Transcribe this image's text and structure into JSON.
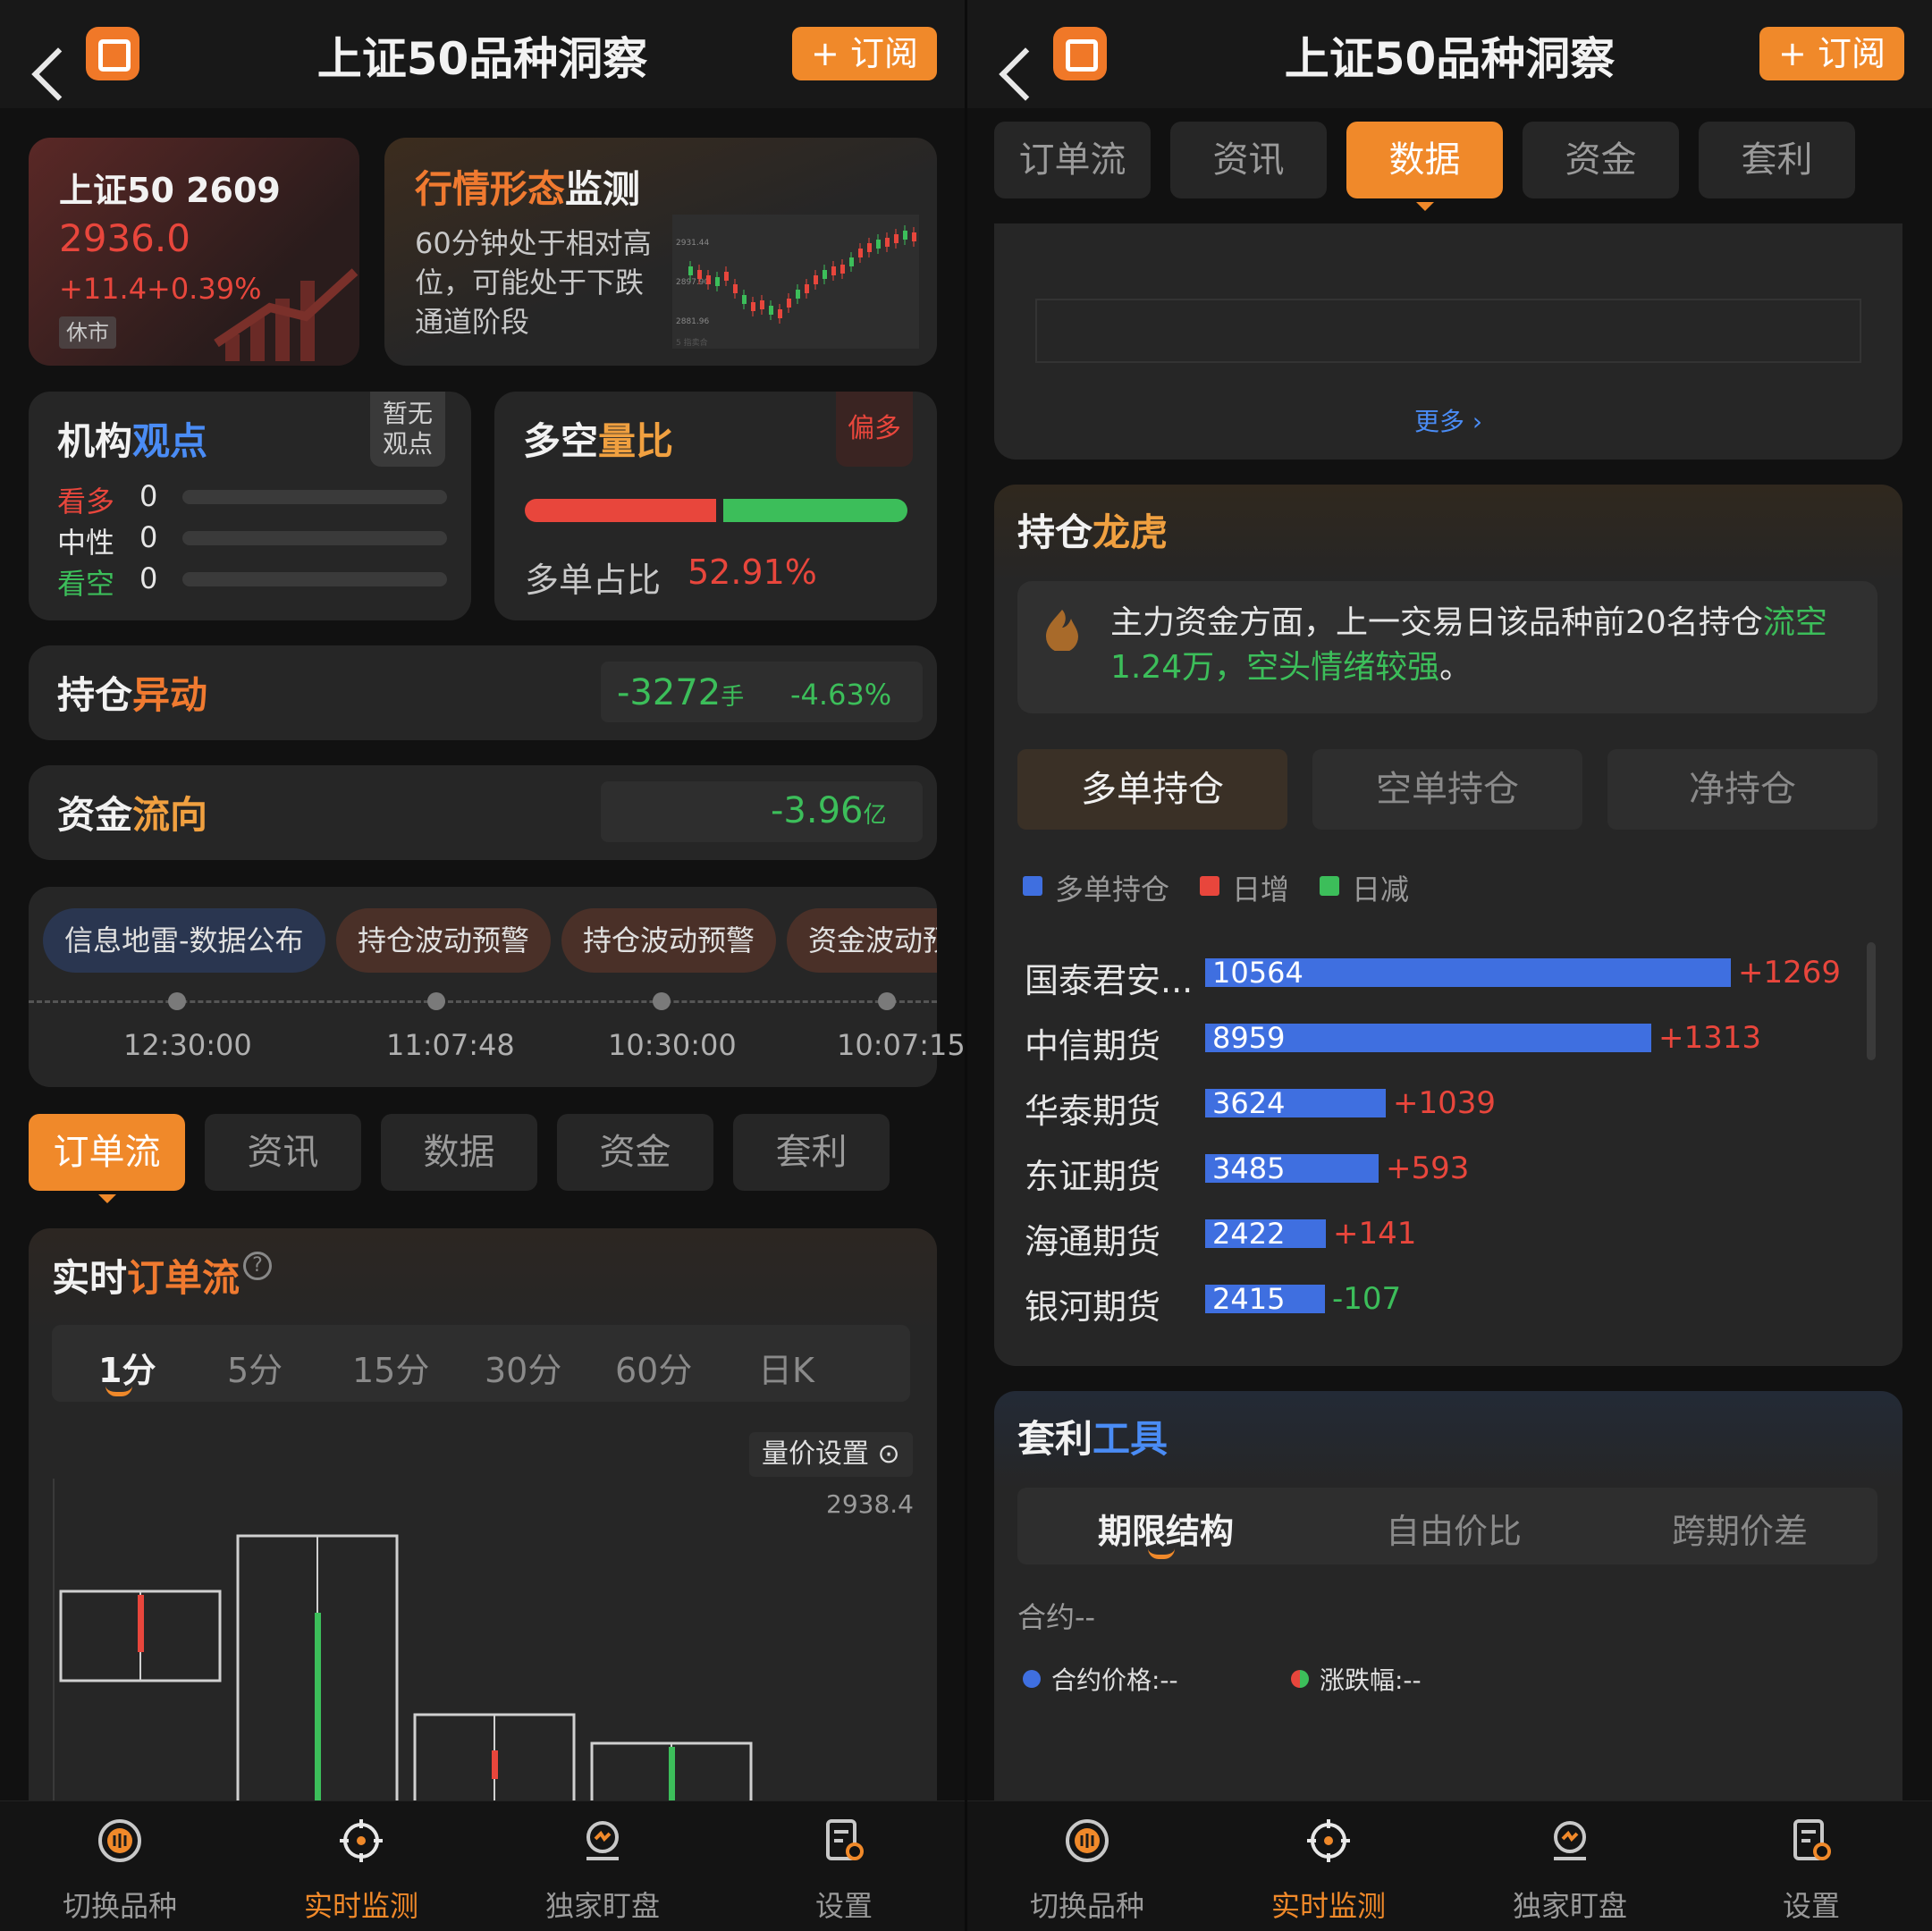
{
  "header": {
    "title": "上证50品种洞察",
    "subscribe_label": "+ 订阅"
  },
  "quote": {
    "name": "上证50 2609",
    "price": "2936.0",
    "change": "+11.4",
    "change_pct": "+0.39%",
    "status": "休市"
  },
  "pattern": {
    "title_a": "行情形态",
    "title_b": "监测",
    "desc": "60分钟处于相对高位，可能处于下跌通道阶段",
    "mini_price_top": "2931.44",
    "mini_price_mid": "2897.90",
    "mini_price_bot": "2881.96",
    "mini_caption": "5 指卖合"
  },
  "views": {
    "title_a": "机构",
    "title_b": "观点",
    "badge": "暂无\n观点",
    "rows": [
      {
        "label": "看多",
        "value": "0"
      },
      {
        "label": "中性",
        "value": "0"
      },
      {
        "label": "看空",
        "value": "0"
      }
    ]
  },
  "longshort": {
    "title_a": "多空",
    "title_b": "量比",
    "badge": "偏多",
    "ratio_label": "多单占比",
    "ratio_value": "52.91%",
    "long_fraction": 0.5291
  },
  "position_change": {
    "title_a": "持仓",
    "title_b": "异动",
    "value": "-3272",
    "unit": "手",
    "pct": "-4.63%"
  },
  "fund_flow": {
    "title_a": "资金",
    "title_b": "流向",
    "value": "-3.96",
    "unit": "亿"
  },
  "timeline": {
    "pills": [
      "信息地雷-数据公布",
      "持仓波动预警",
      "持仓波动预警",
      "资金波动预"
    ],
    "times": [
      "12:30:00",
      "11:07:48",
      "10:30:00",
      "10:07:15"
    ]
  },
  "main_tabs": [
    "订单流",
    "资讯",
    "数据",
    "资金",
    "套利"
  ],
  "orderflow": {
    "title_a": "实时",
    "title_b": "订单流",
    "help_icon": "question-circle-icon",
    "periods": [
      "1分",
      "5分",
      "15分",
      "30分",
      "60分",
      "日K"
    ],
    "setting_label": "量价设置",
    "price_label": "2938.4"
  },
  "data_panel": {
    "more_label": "更多 ›"
  },
  "holdings": {
    "title_a": "持仓",
    "title_b": "龙虎",
    "summary_a": "主力资金方面，上一交易日该品种前20名持仓",
    "summary_b": "流空1.24万，空头情绪较强",
    "summary_c": "。",
    "subtabs": [
      "多单持仓",
      "空单持仓",
      "净持仓"
    ],
    "legend": [
      "多单持仓",
      "日增",
      "日减"
    ],
    "legend_colors": [
      "#3f6fe0",
      "#e8463c",
      "#3cbe5a"
    ],
    "max_value": 10564,
    "rows": [
      {
        "name": "国泰君安...",
        "value": "10564",
        "num": 10564,
        "chg": "+1269",
        "dir": "up"
      },
      {
        "name": "中信期货",
        "value": "8959",
        "num": 8959,
        "chg": "+1313",
        "dir": "up"
      },
      {
        "name": "华泰期货",
        "value": "3624",
        "num": 3624,
        "chg": "+1039",
        "dir": "up"
      },
      {
        "name": "东证期货",
        "value": "3485",
        "num": 3485,
        "chg": "+593",
        "dir": "up"
      },
      {
        "name": "海通期货",
        "value": "2422",
        "num": 2422,
        "chg": "+141",
        "dir": "up"
      },
      {
        "name": "银河期货",
        "value": "2415",
        "num": 2415,
        "chg": "-107",
        "dir": "down"
      }
    ]
  },
  "arbitrage": {
    "title_a": "套利",
    "title_b": "工具",
    "subtabs": [
      "期限结构",
      "自由价比",
      "跨期价差"
    ],
    "contract_label": "合约--",
    "price_label": "合约价格:--",
    "change_label": "涨跌幅:--"
  },
  "nav": [
    {
      "label": "切换品种",
      "icon": "switch-variety-icon"
    },
    {
      "label": "实时监测",
      "icon": "crosshair-icon"
    },
    {
      "label": "独家盯盘",
      "icon": "watch-pin-icon"
    },
    {
      "label": "设置",
      "icon": "settings-doc-icon"
    }
  ],
  "colors": {
    "accent": "#f0892a",
    "up": "#e8463c",
    "down": "#3cbe5a",
    "blue": "#3f6fe0",
    "bg": "#111111",
    "card": "#262626"
  }
}
